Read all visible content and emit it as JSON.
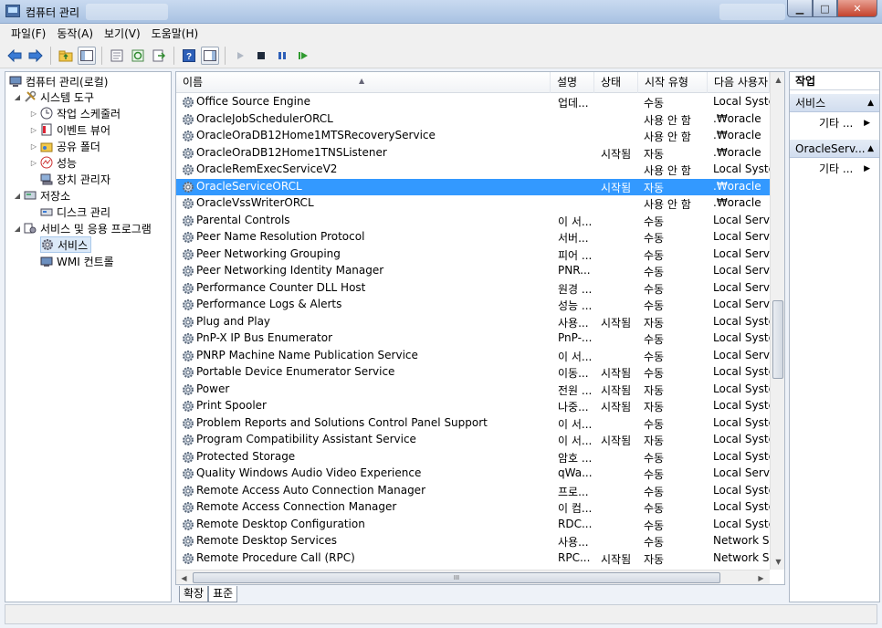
{
  "window": {
    "title": "컴퓨터 관리",
    "minimize": "▁",
    "maximize": "□",
    "close": "✕"
  },
  "menu": [
    "파일(F)",
    "동작(A)",
    "보기(V)",
    "도움말(H)"
  ],
  "tree": {
    "root": "컴퓨터 관리(로컬)",
    "system_tools": "시스템 도구",
    "task_scheduler": "작업 스케줄러",
    "event_viewer": "이벤트 뷰어",
    "shared_folders": "공유 폴더",
    "performance": "성능",
    "device_manager": "장치 관리자",
    "storage": "저장소",
    "disk_management": "디스크 관리",
    "services_apps": "서비스 및 응용 프로그램",
    "services": "서비스",
    "wmi": "WMI 컨트롤"
  },
  "columns": [
    "이름",
    "설명",
    "상태",
    "시작 유형",
    "다음 사용자"
  ],
  "rows": [
    {
      "name": "Office Source Engine",
      "desc": "업데...",
      "status": "",
      "start": "수동",
      "logon": "Local Syster"
    },
    {
      "name": "OracleJobSchedulerORCL",
      "desc": "",
      "status": "",
      "start": "사용 안 함",
      "logon": ".₩oracle"
    },
    {
      "name": "OracleOraDB12Home1MTSRecoveryService",
      "desc": "",
      "status": "",
      "start": "사용 안 함",
      "logon": ".₩oracle"
    },
    {
      "name": "OracleOraDB12Home1TNSListener",
      "desc": "",
      "status": "시작됨",
      "start": "자동",
      "logon": ".₩oracle"
    },
    {
      "name": "OracleRemExecServiceV2",
      "desc": "",
      "status": "",
      "start": "사용 안 함",
      "logon": "Local Syster"
    },
    {
      "name": "OracleServiceORCL",
      "desc": "",
      "status": "시작됨",
      "start": "자동",
      "logon": ".₩oracle",
      "selected": true
    },
    {
      "name": "OracleVssWriterORCL",
      "desc": "",
      "status": "",
      "start": "사용 안 함",
      "logon": ".₩oracle"
    },
    {
      "name": "Parental Controls",
      "desc": "이 서...",
      "status": "",
      "start": "수동",
      "logon": "Local Servic"
    },
    {
      "name": "Peer Name Resolution Protocol",
      "desc": "서버...",
      "status": "",
      "start": "수동",
      "logon": "Local Servic"
    },
    {
      "name": "Peer Networking Grouping",
      "desc": "피어 ...",
      "status": "",
      "start": "수동",
      "logon": "Local Servic"
    },
    {
      "name": "Peer Networking Identity Manager",
      "desc": "PNR...",
      "status": "",
      "start": "수동",
      "logon": "Local Servic"
    },
    {
      "name": "Performance Counter DLL Host",
      "desc": "원경 ...",
      "status": "",
      "start": "수동",
      "logon": "Local Servic"
    },
    {
      "name": "Performance Logs & Alerts",
      "desc": "성능 ...",
      "status": "",
      "start": "수동",
      "logon": "Local Servic"
    },
    {
      "name": "Plug and Play",
      "desc": "사용...",
      "status": "시작됨",
      "start": "자동",
      "logon": "Local Syster"
    },
    {
      "name": "PnP-X IP Bus Enumerator",
      "desc": "PnP-...",
      "status": "",
      "start": "수동",
      "logon": "Local Syster"
    },
    {
      "name": "PNRP Machine Name Publication Service",
      "desc": "이 서...",
      "status": "",
      "start": "수동",
      "logon": "Local Servic"
    },
    {
      "name": "Portable Device Enumerator Service",
      "desc": "이동...",
      "status": "시작됨",
      "start": "수동",
      "logon": "Local Syster"
    },
    {
      "name": "Power",
      "desc": "전원 ...",
      "status": "시작됨",
      "start": "자동",
      "logon": "Local Syster"
    },
    {
      "name": "Print Spooler",
      "desc": "나중...",
      "status": "시작됨",
      "start": "자동",
      "logon": "Local Syster"
    },
    {
      "name": "Problem Reports and Solutions Control Panel Support",
      "desc": "이 서...",
      "status": "",
      "start": "수동",
      "logon": "Local Syster"
    },
    {
      "name": "Program Compatibility Assistant Service",
      "desc": "이 서...",
      "status": "시작됨",
      "start": "자동",
      "logon": "Local Syster"
    },
    {
      "name": "Protected Storage",
      "desc": "암호 ...",
      "status": "",
      "start": "수동",
      "logon": "Local Syster"
    },
    {
      "name": "Quality Windows Audio Video Experience",
      "desc": "qWa...",
      "status": "",
      "start": "수동",
      "logon": "Local Servic"
    },
    {
      "name": "Remote Access Auto Connection Manager",
      "desc": "프로...",
      "status": "",
      "start": "수동",
      "logon": "Local Syster"
    },
    {
      "name": "Remote Access Connection Manager",
      "desc": "이 컴...",
      "status": "",
      "start": "수동",
      "logon": "Local Syster"
    },
    {
      "name": "Remote Desktop Configuration",
      "desc": "RDC...",
      "status": "",
      "start": "수동",
      "logon": "Local Syster"
    },
    {
      "name": "Remote Desktop Services",
      "desc": "사용...",
      "status": "",
      "start": "수동",
      "logon": "Network Ser"
    },
    {
      "name": "Remote Procedure Call (RPC)",
      "desc": "RPC...",
      "status": "시작됨",
      "start": "자동",
      "logon": "Network Ser"
    }
  ],
  "tabs": [
    "확장",
    "표준"
  ],
  "actions": {
    "header": "작업",
    "group1": "서비스",
    "group1_item": "기타 ...",
    "group2": "OracleServ...",
    "group2_item": "기타 ..."
  },
  "colors": {
    "selection": "#3399ff",
    "title_bar": "#b9cfe9",
    "close_button": "#c4422c"
  }
}
